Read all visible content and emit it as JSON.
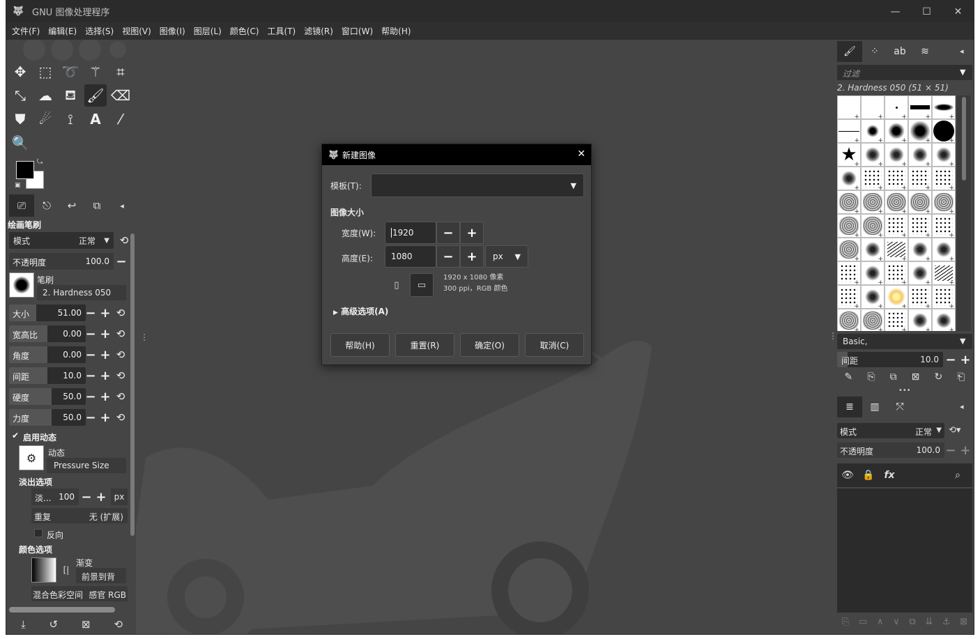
{
  "window": {
    "title": "GNU 图像处理程序",
    "controls": {
      "minimize": "—",
      "maximize": "☐",
      "close": "✕"
    }
  },
  "menubar": [
    "文件(F)",
    "编辑(E)",
    "选择(S)",
    "视图(V)",
    "图像(I)",
    "图层(L)",
    "颜色(C)",
    "工具(T)",
    "滤镜(R)",
    "窗口(W)",
    "帮助(H)"
  ],
  "tool_options": {
    "title": "绘画笔刷",
    "mode_label": "模式",
    "mode_value": "正常",
    "opacity_label": "不透明度",
    "opacity_value": "100.0",
    "brush_label": "笔刷",
    "brush_value": "2. Hardness 050",
    "sliders": [
      {
        "label": "大小",
        "value": "51.00",
        "fill": 0.35
      },
      {
        "label": "宽高比",
        "value": "0.00",
        "fill": 0.5
      },
      {
        "label": "角度",
        "value": "0.00",
        "fill": 0.5
      },
      {
        "label": "间距",
        "value": "10.0",
        "fill": 0.1
      },
      {
        "label": "硬度",
        "value": "50.0",
        "fill": 0.5
      },
      {
        "label": "力度",
        "value": "50.0",
        "fill": 0.5
      }
    ],
    "dynamics_enable": "启用动态",
    "dynamics_label": "动态",
    "dynamics_value": "Pressure Size",
    "fade_title": "淡出选项",
    "fade_label": "淡...",
    "fade_value": "100",
    "fade_unit": "px",
    "repeat_label": "重复",
    "repeat_value": "无 (扩展)",
    "reverse_label": "反向",
    "color_title": "颜色选项",
    "gradient_label": "渐变",
    "gradient_value": "前景到背",
    "blend_label": "混合色彩空间",
    "blend_value": "感官 RGB"
  },
  "brushes_panel": {
    "filter_placeholder": "过滤",
    "current_brush": "2. Hardness 050 (51 × 51)",
    "tag": "Basic,",
    "spacing_label": "间距",
    "spacing_value": "10.0",
    "spacing_fill": 0.1
  },
  "layers_panel": {
    "mode_label": "模式",
    "mode_value": "正常",
    "opacity_label": "不透明度",
    "opacity_value": "100.0",
    "opacity_fill": 1.0
  },
  "dialog": {
    "title": "新建图像",
    "template_label": "模板(T):",
    "size_title": "图像大小",
    "width_label": "宽度(W):",
    "width_value": "1920",
    "height_label": "高度(E):",
    "height_value": "1080",
    "unit": "px",
    "info_line1": "1920 x 1080 像素",
    "info_line2": "300 ppi，RGB 颜色",
    "advanced": "高级选项(A)",
    "buttons": {
      "help": "帮助(H)",
      "reset": "重置(R)",
      "ok": "确定(O)",
      "cancel": "取消(C)"
    }
  }
}
